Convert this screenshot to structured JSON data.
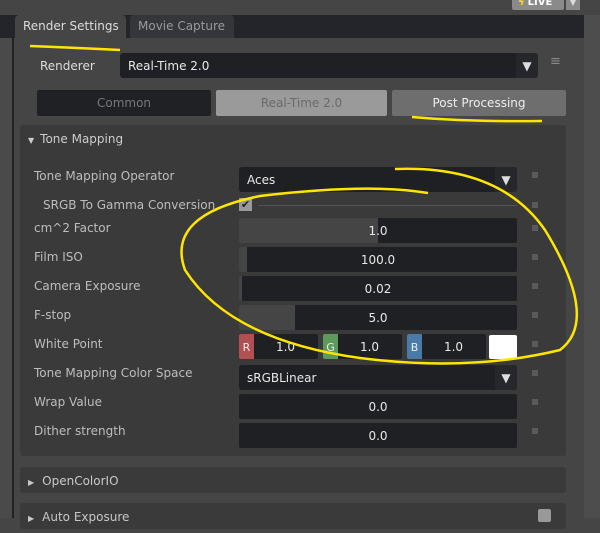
{
  "header": {
    "live_label": "LIVE",
    "tabs": [
      "Render Settings",
      "Movie Capture"
    ]
  },
  "renderer": {
    "label": "Renderer",
    "value": "Real-Time 2.0"
  },
  "subtabs": [
    "Common",
    "Real-Time 2.0",
    "Post Processing"
  ],
  "tone_mapping": {
    "title": "Tone Mapping",
    "operator": {
      "label": "Tone Mapping Operator",
      "value": "Aces"
    },
    "srgb": {
      "label": "SRGB To Gamma Conversion",
      "checked": true
    },
    "cm2": {
      "label": "cm^2 Factor",
      "value": "1.0",
      "fill": 0.5
    },
    "iso": {
      "label": "Film ISO",
      "value": "100.0",
      "fill": 0.03
    },
    "exposure": {
      "label": "Camera Exposure",
      "value": "0.02",
      "fill": 0.01
    },
    "fstop": {
      "label": "F-stop",
      "value": "5.0",
      "fill": 0.2
    },
    "white_point": {
      "label": "White Point",
      "r_label": "R",
      "g_label": "G",
      "b_label": "B",
      "r": "1.0",
      "g": "1.0",
      "b": "1.0",
      "swatch": "#ffffff"
    },
    "color_space": {
      "label": "Tone Mapping Color Space",
      "value": "sRGBLinear"
    },
    "wrap": {
      "label": "Wrap Value",
      "value": "0.0"
    },
    "dither": {
      "label": "Dither strength",
      "value": "0.0"
    }
  },
  "sections": [
    "OpenColorIO",
    "Auto Exposure"
  ],
  "colors": {
    "annotation": "#ffe600",
    "r": "#b05050",
    "g": "#5c9a5c",
    "b": "#4a7aa8"
  }
}
